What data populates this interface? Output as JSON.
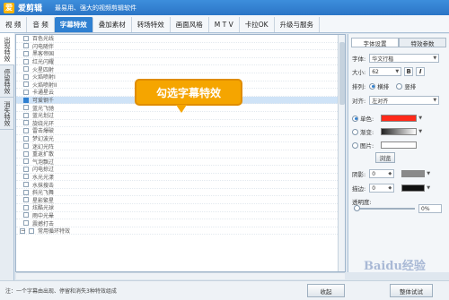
{
  "title_bar": {
    "app_name": "爱剪辑",
    "logo_char": "爱",
    "tagline": "最易用、强大的视频剪辑软件"
  },
  "menu_tabs": [
    {
      "label": "视  频",
      "active": false
    },
    {
      "label": "音  频",
      "active": false
    },
    {
      "label": "字幕特效",
      "active": true
    },
    {
      "label": "叠加素材",
      "active": false
    },
    {
      "label": "转场特效",
      "active": false
    },
    {
      "label": "画面风格",
      "active": false
    },
    {
      "label": "M T V",
      "active": false
    },
    {
      "label": "卡拉OK",
      "active": false
    },
    {
      "label": "升级与服务",
      "active": false
    }
  ],
  "side_tabs": [
    {
      "label": "出现特效",
      "active": true
    },
    {
      "label": "停留特效",
      "active": false
    },
    {
      "label": "消失特效",
      "active": false
    }
  ],
  "effects": [
    {
      "label": "百色光线",
      "checked": false
    },
    {
      "label": "闪电随伴",
      "checked": false
    },
    {
      "label": "黑客帝国",
      "checked": false
    },
    {
      "label": "红光闪耀",
      "checked": false
    },
    {
      "label": "火星四射",
      "checked": false
    },
    {
      "label": "火焰喷射I",
      "checked": false
    },
    {
      "label": "火焰喷射II",
      "checked": false
    },
    {
      "label": "卡通星云",
      "checked": false
    },
    {
      "label": "可爱钢千",
      "checked": true,
      "selected": true
    },
    {
      "label": "蓝光飞驰",
      "checked": false
    },
    {
      "label": "蓝光划过",
      "checked": false
    },
    {
      "label": "旋绕光环",
      "checked": false
    },
    {
      "label": "雷击爆破",
      "checked": false
    },
    {
      "label": "梦幻波光",
      "checked": false
    },
    {
      "label": "迷幻光阵",
      "checked": false
    },
    {
      "label": "重返扩散",
      "checked": false
    },
    {
      "label": "气泡飘过",
      "checked": false
    },
    {
      "label": "闪电掠过",
      "checked": false
    },
    {
      "label": "水光光漾",
      "checked": false
    },
    {
      "label": "水抹搜击",
      "checked": false
    },
    {
      "label": "斜光飞舞",
      "checked": false
    },
    {
      "label": "星影繁星",
      "checked": false
    },
    {
      "label": "炫酷光球",
      "checked": false
    },
    {
      "label": "雨中光晕",
      "checked": false
    },
    {
      "label": "震撼打击",
      "checked": false
    }
  ],
  "group_label": "常用循环特效",
  "callout": "勾选字幕特效",
  "panel": {
    "tabs": [
      {
        "label": "字体设置",
        "active": true
      },
      {
        "label": "特效参数",
        "active": false
      }
    ],
    "font_label": "字体:",
    "font_value": "华文行楷",
    "size_label": "大小:",
    "size_value": "62",
    "bold": "B",
    "italic": "I",
    "layout_label": "排列:",
    "horizontal": "横排",
    "vertical": "竖排",
    "align_label": "对齐:",
    "align_value": "左对齐",
    "mono_label": "单色:",
    "gradient_label": "渐变:",
    "image_label": "图片:",
    "browse": "浏览",
    "shadow_label": "阴影:",
    "shadow_value": "0",
    "stroke_label": "描边:",
    "stroke_value": "0",
    "opacity_label": "透明度:",
    "opacity_value": "0%",
    "mono_color": "#ff2a1a"
  },
  "status": {
    "text": "注：一个字幕由出现、停留和消失3种特效组成",
    "fav_button": "收起",
    "try_button": "整体试试"
  },
  "watermark": "Baidu经验"
}
